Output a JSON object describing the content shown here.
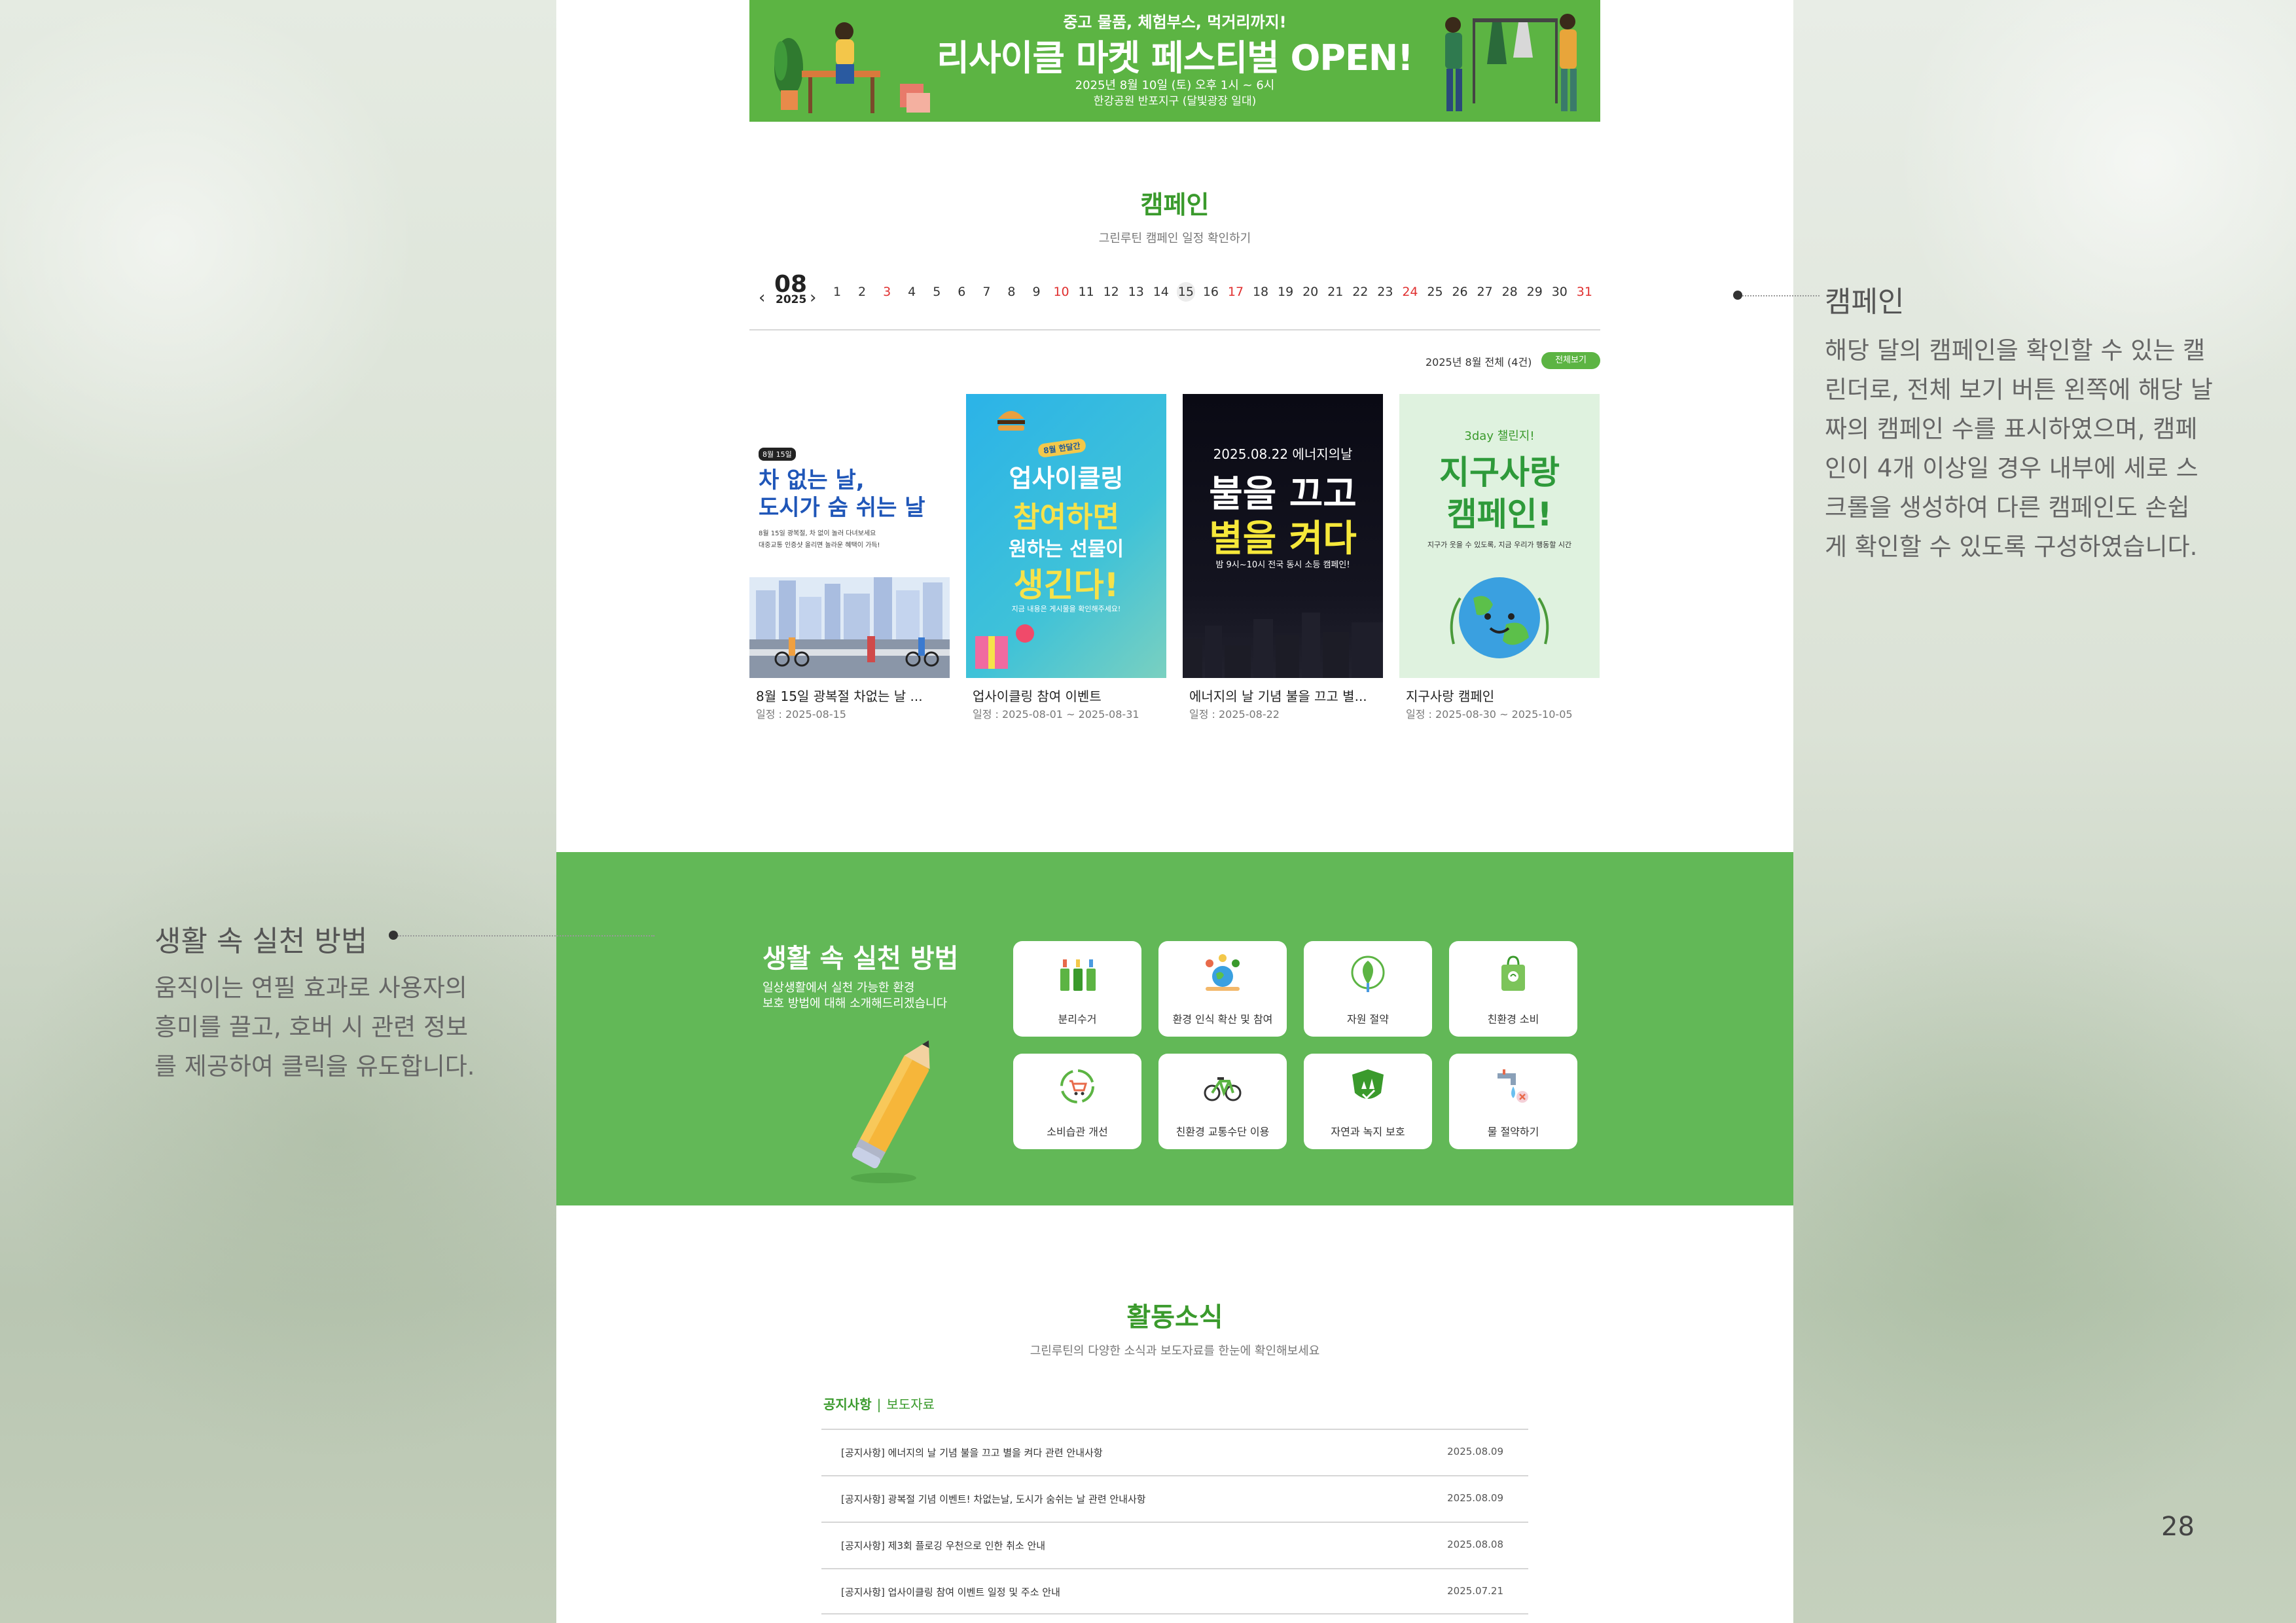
{
  "banner": {
    "sub": "중고 물품, 체험부스, 먹거리까지!",
    "title": "리사이클 마켓 페스티벌 OPEN!",
    "date": "2025년 8월 10일 (토) 오후 1시 ~ 6시",
    "place": "한강공원 반포지구 (달빛광장 일대)"
  },
  "campaign": {
    "title": "캠페인",
    "subtitle": "그린루틴 캠페인 일정 확인하기",
    "calendar": {
      "prev_icon": "chevron-left-icon",
      "next_icon": "chevron-right-icon",
      "month": "08",
      "year": "2025",
      "days": [
        "1",
        "2",
        "3",
        "4",
        "5",
        "6",
        "7",
        "8",
        "9",
        "10",
        "11",
        "12",
        "13",
        "14",
        "15",
        "16",
        "17",
        "18",
        "19",
        "20",
        "21",
        "22",
        "23",
        "24",
        "25",
        "26",
        "27",
        "28",
        "29",
        "30",
        "31"
      ],
      "red_days": [
        "3",
        "10",
        "17",
        "24",
        "31"
      ],
      "today": "15"
    },
    "summary": "2025년 8월 전체 (4건)",
    "view_all": "전체보기",
    "cards": [
      {
        "name": "8월 15일 광복절 차없는 날 ...",
        "date": "일정 : 2025-08-15",
        "tag": "8월 15일",
        "poster_line1": "차 없는 날,",
        "poster_line2": "도시가 숨 쉬는 날",
        "poster_small1": "8월 15일 광복절, 차 없이 놀러 다녀보세요",
        "poster_small2": "대중교통 인증샷 올리면 놀라운 혜택이 가득!"
      },
      {
        "name": "업사이클링 참여 이벤트",
        "date": "일정 : 2025-08-01 ~ 2025-08-31",
        "tag": "8월 한달간",
        "poster_line1": "업사이클링",
        "poster_line2": "참여하면",
        "poster_line3": "원하는 선물이",
        "poster_line4": "생긴다!",
        "poster_small1": "지금 내용은 게시물을 확인해주세요!"
      },
      {
        "name": "에너지의 날 기념 불을 끄고 별...",
        "date": "일정 : 2025-08-22",
        "poster_top": "2025.08.22 에너지의날",
        "poster_line1": "불을 끄고",
        "poster_line2": "별을 켜다",
        "poster_small1": "밤 9시~10시 전국 동시 소등 캠페인!"
      },
      {
        "name": "지구사랑 캠페인",
        "date": "일정 : 2025-08-30 ~ 2025-10-05",
        "poster_top": "3day 챌린지!",
        "poster_line1": "지구사랑",
        "poster_line2": "캠페인!",
        "poster_small1": "지구가 웃을 수 있도록, 지금 우리가 행동할 시간"
      }
    ]
  },
  "practice": {
    "title": "생활 속 실천 방법",
    "subtitle_1": "일상생활에서 실천 가능한 환경",
    "subtitle_2": "보호 방법에 대해 소개해드리겠습니다",
    "tiles": [
      {
        "label": "분리수거",
        "icon": "recycle-bins-icon"
      },
      {
        "label": "환경 인식 확산 및 참여",
        "icon": "people-earth-icon"
      },
      {
        "label": "자원 절약",
        "icon": "leaf-plug-icon"
      },
      {
        "label": "친환경 소비",
        "icon": "eco-bag-icon"
      },
      {
        "label": "소비습관 개선",
        "icon": "cart-cycle-icon"
      },
      {
        "label": "친환경 교통수단 이용",
        "icon": "bicycle-icon"
      },
      {
        "label": "자연과 녹지 보호",
        "icon": "tree-shield-icon"
      },
      {
        "label": "물 절약하기",
        "icon": "water-tap-icon"
      }
    ]
  },
  "news": {
    "title": "활동소식",
    "subtitle": "그린루틴의 다양한 소식과 보도자료를 한눈에 확인해보세요",
    "tab_1": "공지사항",
    "tab_sep": "|",
    "tab_2": "보도자료",
    "items": [
      {
        "text": "[공지사항] 에너지의 날 기념 불을 끄고 별을 켜다 관련 안내사항",
        "date": "2025.08.09"
      },
      {
        "text": "[공지사항] 광복절 기념 이벤트! 차없는날, 도시가 숨쉬는 날 관련 안내사항",
        "date": "2025.08.09"
      },
      {
        "text": "[공지사항] 제3회 플로깅 우천으로 인한 취소 안내",
        "date": "2025.08.08"
      },
      {
        "text": "[공지사항] 업사이클링 참여 이벤트 일정 및 주소 안내",
        "date": "2025.07.21"
      }
    ]
  },
  "annotations": {
    "right_title": "캠페인",
    "right_lines": [
      "해당 달의 캠페인을 확인할 수 있는 캘",
      "린더로, 전체 보기 버튼 왼쪽에 해당 날",
      "짜의 캠페인 수를 표시하였으며, 캠페",
      "인이 4개 이상일 경우 내부에 세로 스",
      "크롤을 생성하여 다른 캠페인도 손쉽",
      "게 확인할 수 있도록 구성하였습니다."
    ],
    "left_title": "생활 속 실천 방법",
    "left_lines": [
      "움직이는 연필 효과로 사용자의",
      "흥미를 끌고, 호버 시 관련 정보",
      "를 제공하여 클릭을 유도합니다."
    ]
  },
  "page_number": "28",
  "colors": {
    "brand_green": "#5cb443",
    "title_green": "#3a9a2c",
    "band_green": "#62b857",
    "sunday_red": "#e03030"
  }
}
